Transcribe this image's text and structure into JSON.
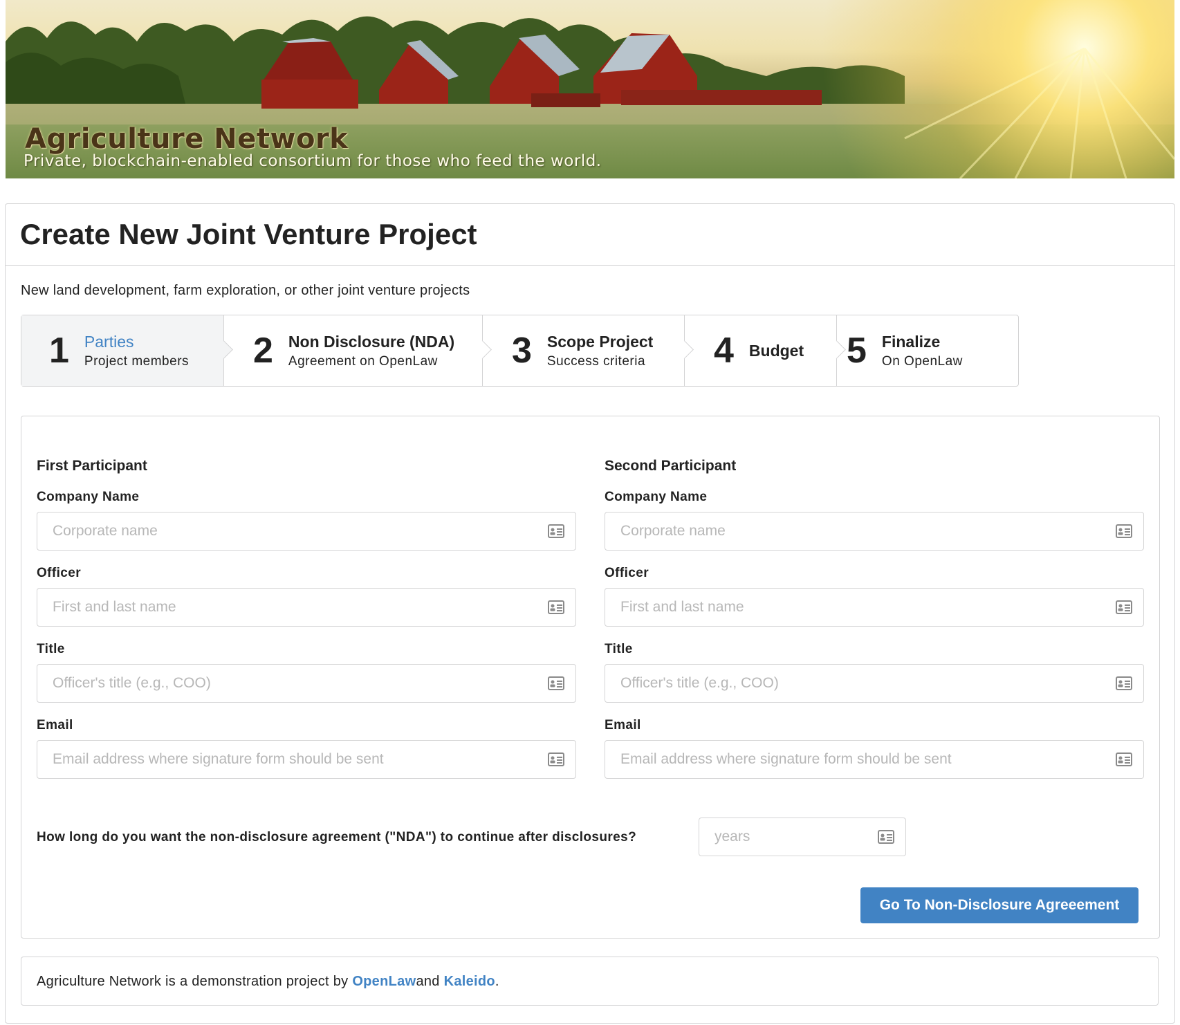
{
  "banner": {
    "title": "Agriculture Network",
    "subtitle": "Private, blockchain-enabled consortium for those who feed the world."
  },
  "page": {
    "title": "Create New Joint Venture Project",
    "description": "New land development, farm exploration, or other joint venture projects"
  },
  "steps": [
    {
      "number": "1",
      "title": "Parties",
      "subtitle": "Project members",
      "active": true
    },
    {
      "number": "2",
      "title": "Non Disclosure (NDA)",
      "subtitle": "Agreement on OpenLaw",
      "active": false
    },
    {
      "number": "3",
      "title": "Scope Project",
      "subtitle": "Success criteria",
      "active": false
    },
    {
      "number": "4",
      "title": "Budget",
      "subtitle": "",
      "active": false
    },
    {
      "number": "5",
      "title": "Finalize",
      "subtitle": "On OpenLaw",
      "active": false
    }
  ],
  "first": {
    "heading": "First Participant",
    "company_label": "Company Name",
    "company_placeholder": "Corporate name",
    "officer_label": "Officer",
    "officer_placeholder": "First and last name",
    "title_label": "Title",
    "title_placeholder": "Officer's title (e.g., COO)",
    "email_label": "Email",
    "email_placeholder": "Email address where signature form should be sent"
  },
  "second": {
    "heading": "Second Participant",
    "company_label": "Company Name",
    "company_placeholder": "Corporate name",
    "officer_label": "Officer",
    "officer_placeholder": "First and last name",
    "title_label": "Title",
    "title_placeholder": "Officer's title (e.g., COO)",
    "email_label": "Email",
    "email_placeholder": "Email address where signature form should be sent"
  },
  "nda": {
    "question": "How long do you want the non-disclosure agreement (\"NDA\") to continue after disclosures?",
    "placeholder": "years"
  },
  "submit_label": "Go To Non-Disclosure Agreeement",
  "footer": {
    "prefix": "Agriculture Network is a demonstration project by ",
    "link1": "OpenLaw",
    "middle": "and ",
    "link2": "Kaleido",
    "suffix": "."
  },
  "icons": {
    "field_icon": "id-card-icon"
  },
  "colors": {
    "accent": "#4183c4",
    "border": "#d4d4d5",
    "active_step_bg": "#f3f4f5"
  }
}
